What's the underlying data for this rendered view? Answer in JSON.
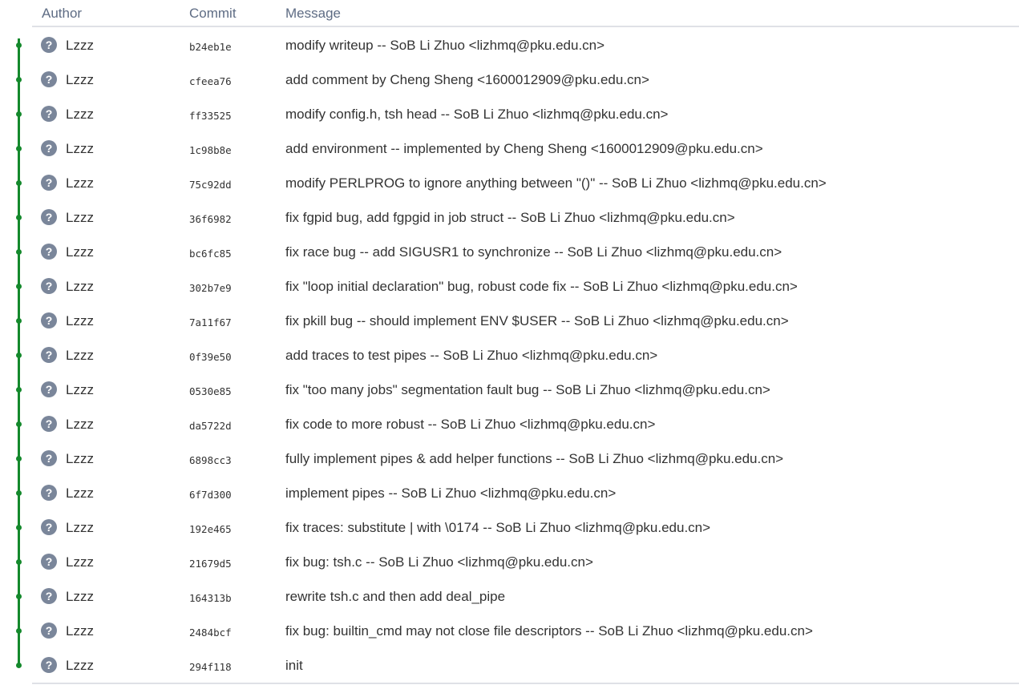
{
  "table": {
    "headers": {
      "author": "Author",
      "commit": "Commit",
      "message": "Message"
    },
    "avatar_glyph": "?",
    "graph_color": "#14892c",
    "commits": [
      {
        "author": "Lzzz",
        "hash": "b24eb1e",
        "message": "modify writeup -- SoB Li Zhuo <lizhmq@pku.edu.cn>"
      },
      {
        "author": "Lzzz",
        "hash": "cfeea76",
        "message": "add comment by Cheng Sheng <1600012909@pku.edu.cn>"
      },
      {
        "author": "Lzzz",
        "hash": "ff33525",
        "message": "modify config.h, tsh head -- SoB Li Zhuo <lizhmq@pku.edu.cn>"
      },
      {
        "author": "Lzzz",
        "hash": "1c98b8e",
        "message": "add environment -- implemented by Cheng Sheng <1600012909@pku.edu.cn>"
      },
      {
        "author": "Lzzz",
        "hash": "75c92dd",
        "message": "modify PERLPROG to ignore anything between \"()\" -- SoB Li Zhuo <lizhmq@pku.edu.cn>"
      },
      {
        "author": "Lzzz",
        "hash": "36f6982",
        "message": "fix fgpid bug, add fgpgid in job struct -- SoB Li Zhuo <lizhmq@pku.edu.cn>"
      },
      {
        "author": "Lzzz",
        "hash": "bc6fc85",
        "message": "fix race bug -- add SIGUSR1 to synchronize -- SoB Li Zhuo <lizhmq@pku.edu.cn>"
      },
      {
        "author": "Lzzz",
        "hash": "302b7e9",
        "message": "fix \"loop initial declaration\" bug, robust code fix -- SoB Li Zhuo <lizhmq@pku.edu.cn>"
      },
      {
        "author": "Lzzz",
        "hash": "7a11f67",
        "message": "fix pkill bug -- should implement ENV $USER -- SoB Li Zhuo <lizhmq@pku.edu.cn>"
      },
      {
        "author": "Lzzz",
        "hash": "0f39e50",
        "message": "add traces to test pipes -- SoB Li Zhuo <lizhmq@pku.edu.cn>"
      },
      {
        "author": "Lzzz",
        "hash": "0530e85",
        "message": "fix \"too many jobs\" segmentation fault bug -- SoB Li Zhuo <lizhmq@pku.edu.cn>"
      },
      {
        "author": "Lzzz",
        "hash": "da5722d",
        "message": "fix code to more robust -- SoB Li Zhuo <lizhmq@pku.edu.cn>"
      },
      {
        "author": "Lzzz",
        "hash": "6898cc3",
        "message": "fully implement pipes & add helper functions -- SoB Li Zhuo <lizhmq@pku.edu.cn>"
      },
      {
        "author": "Lzzz",
        "hash": "6f7d300",
        "message": "implement pipes -- SoB Li Zhuo <lizhmq@pku.edu.cn>"
      },
      {
        "author": "Lzzz",
        "hash": "192e465",
        "message": "fix traces: substitute | with \\0174 -- SoB Li Zhuo <lizhmq@pku.edu.cn>"
      },
      {
        "author": "Lzzz",
        "hash": "21679d5",
        "message": "fix bug: tsh.c -- SoB Li Zhuo <lizhmq@pku.edu.cn>"
      },
      {
        "author": "Lzzz",
        "hash": "164313b",
        "message": "rewrite tsh.c and then add deal_pipe"
      },
      {
        "author": "Lzzz",
        "hash": "2484bcf",
        "message": "fix bug: builtin_cmd may not close file descriptors -- SoB Li Zhuo <lizhmq@pku.edu.cn>"
      },
      {
        "author": "Lzzz",
        "hash": "294f118",
        "message": "init"
      }
    ]
  }
}
